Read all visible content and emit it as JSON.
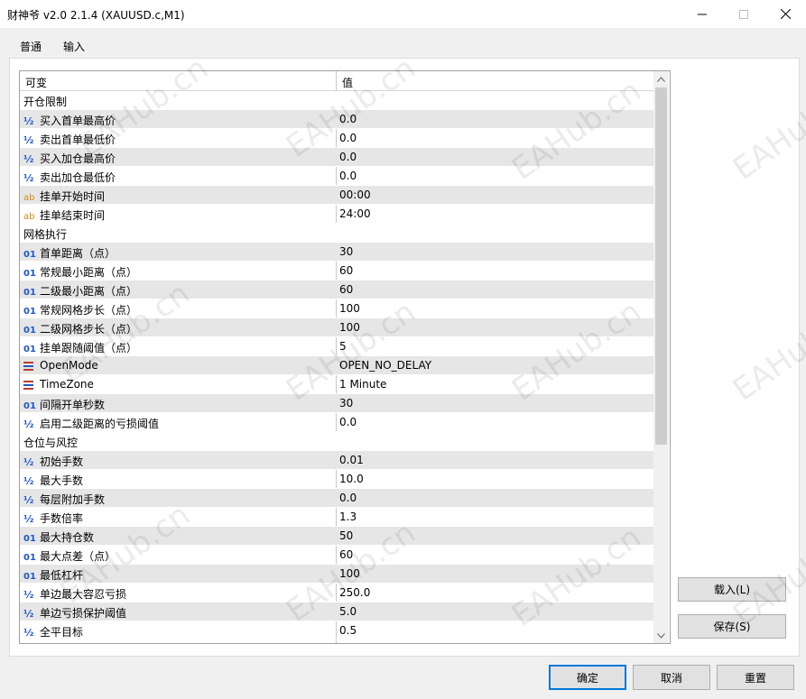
{
  "window": {
    "title": "财神爷 v2.0 2.1.4 (XAUUSD.c,M1)"
  },
  "tabs": [
    {
      "label": "普通",
      "active": false
    },
    {
      "label": "输入",
      "active": true
    }
  ],
  "grid": {
    "columns": [
      "可变",
      "值"
    ],
    "rows": [
      {
        "type": "group",
        "name": "开仓限制",
        "value": ""
      },
      {
        "type": "param",
        "icon": "½",
        "icon_kind": "half",
        "name": "买入首单最高价",
        "value": "0.0"
      },
      {
        "type": "param",
        "icon": "½",
        "icon_kind": "half",
        "name": "卖出首单最低价",
        "value": "0.0"
      },
      {
        "type": "param",
        "icon": "½",
        "icon_kind": "half",
        "name": "买入加仓最高价",
        "value": "0.0"
      },
      {
        "type": "param",
        "icon": "½",
        "icon_kind": "half",
        "name": "卖出加仓最低价",
        "value": "0.0"
      },
      {
        "type": "param",
        "icon": "ab",
        "icon_kind": "str",
        "name": "挂单开始时间",
        "value": "00:00"
      },
      {
        "type": "param",
        "icon": "ab",
        "icon_kind": "str",
        "name": "挂单结束时间",
        "value": "24:00"
      },
      {
        "type": "group",
        "name": "网格执行",
        "value": ""
      },
      {
        "type": "param",
        "icon": "01",
        "icon_kind": "num",
        "name": "首单距离（点）",
        "value": "30"
      },
      {
        "type": "param",
        "icon": "01",
        "icon_kind": "num",
        "name": "常规最小距离（点）",
        "value": "60"
      },
      {
        "type": "param",
        "icon": "01",
        "icon_kind": "num",
        "name": "二级最小距离（点）",
        "value": "60"
      },
      {
        "type": "param",
        "icon": "01",
        "icon_kind": "num",
        "name": "常规网格步长（点）",
        "value": "100"
      },
      {
        "type": "param",
        "icon": "01",
        "icon_kind": "num",
        "name": "二级网格步长（点）",
        "value": "100"
      },
      {
        "type": "param",
        "icon": "01",
        "icon_kind": "num",
        "name": "挂单跟随阈值（点）",
        "value": "5"
      },
      {
        "type": "param",
        "icon": "",
        "icon_kind": "enum",
        "name": "OpenMode",
        "value": "OPEN_NO_DELAY"
      },
      {
        "type": "param",
        "icon": "",
        "icon_kind": "enum",
        "name": "TimeZone",
        "value": "1 Minute"
      },
      {
        "type": "param",
        "icon": "01",
        "icon_kind": "num",
        "name": "间隔开单秒数",
        "value": "30"
      },
      {
        "type": "param",
        "icon": "½",
        "icon_kind": "half",
        "name": "启用二级距离的亏损阈值",
        "value": "0.0"
      },
      {
        "type": "group",
        "name": "仓位与风控",
        "value": ""
      },
      {
        "type": "param",
        "icon": "½",
        "icon_kind": "half",
        "name": "初始手数",
        "value": "0.01"
      },
      {
        "type": "param",
        "icon": "½",
        "icon_kind": "half",
        "name": "最大手数",
        "value": "10.0"
      },
      {
        "type": "param",
        "icon": "½",
        "icon_kind": "half",
        "name": "每层附加手数",
        "value": "0.0"
      },
      {
        "type": "param",
        "icon": "½",
        "icon_kind": "half",
        "name": "手数倍率",
        "value": "1.3"
      },
      {
        "type": "param",
        "icon": "01",
        "icon_kind": "num",
        "name": "最大持仓数",
        "value": "50"
      },
      {
        "type": "param",
        "icon": "01",
        "icon_kind": "num",
        "name": "最大点差（点）",
        "value": "60"
      },
      {
        "type": "param",
        "icon": "01",
        "icon_kind": "num",
        "name": "最低杠杆",
        "value": "100"
      },
      {
        "type": "param",
        "icon": "½",
        "icon_kind": "half",
        "name": "单边最大容忍亏损",
        "value": "250.0"
      },
      {
        "type": "param",
        "icon": "½",
        "icon_kind": "half",
        "name": "单边亏损保护阈值",
        "value": "5.0"
      },
      {
        "type": "param",
        "icon": "½",
        "icon_kind": "half",
        "name": "全平目标",
        "value": "0.5"
      }
    ]
  },
  "side_buttons": {
    "load": "载入(L)",
    "save": "保存(S)"
  },
  "footer_buttons": {
    "ok": "确定",
    "cancel": "取消",
    "reset": "重置"
  },
  "watermark": "EAHub.cn",
  "colors": {
    "accent": "#0078d7",
    "tab_underline": "#1e6fd6",
    "row_alt": "#e6e6e6",
    "icon_num": "#1f56c9",
    "icon_str": "#d08a12"
  }
}
